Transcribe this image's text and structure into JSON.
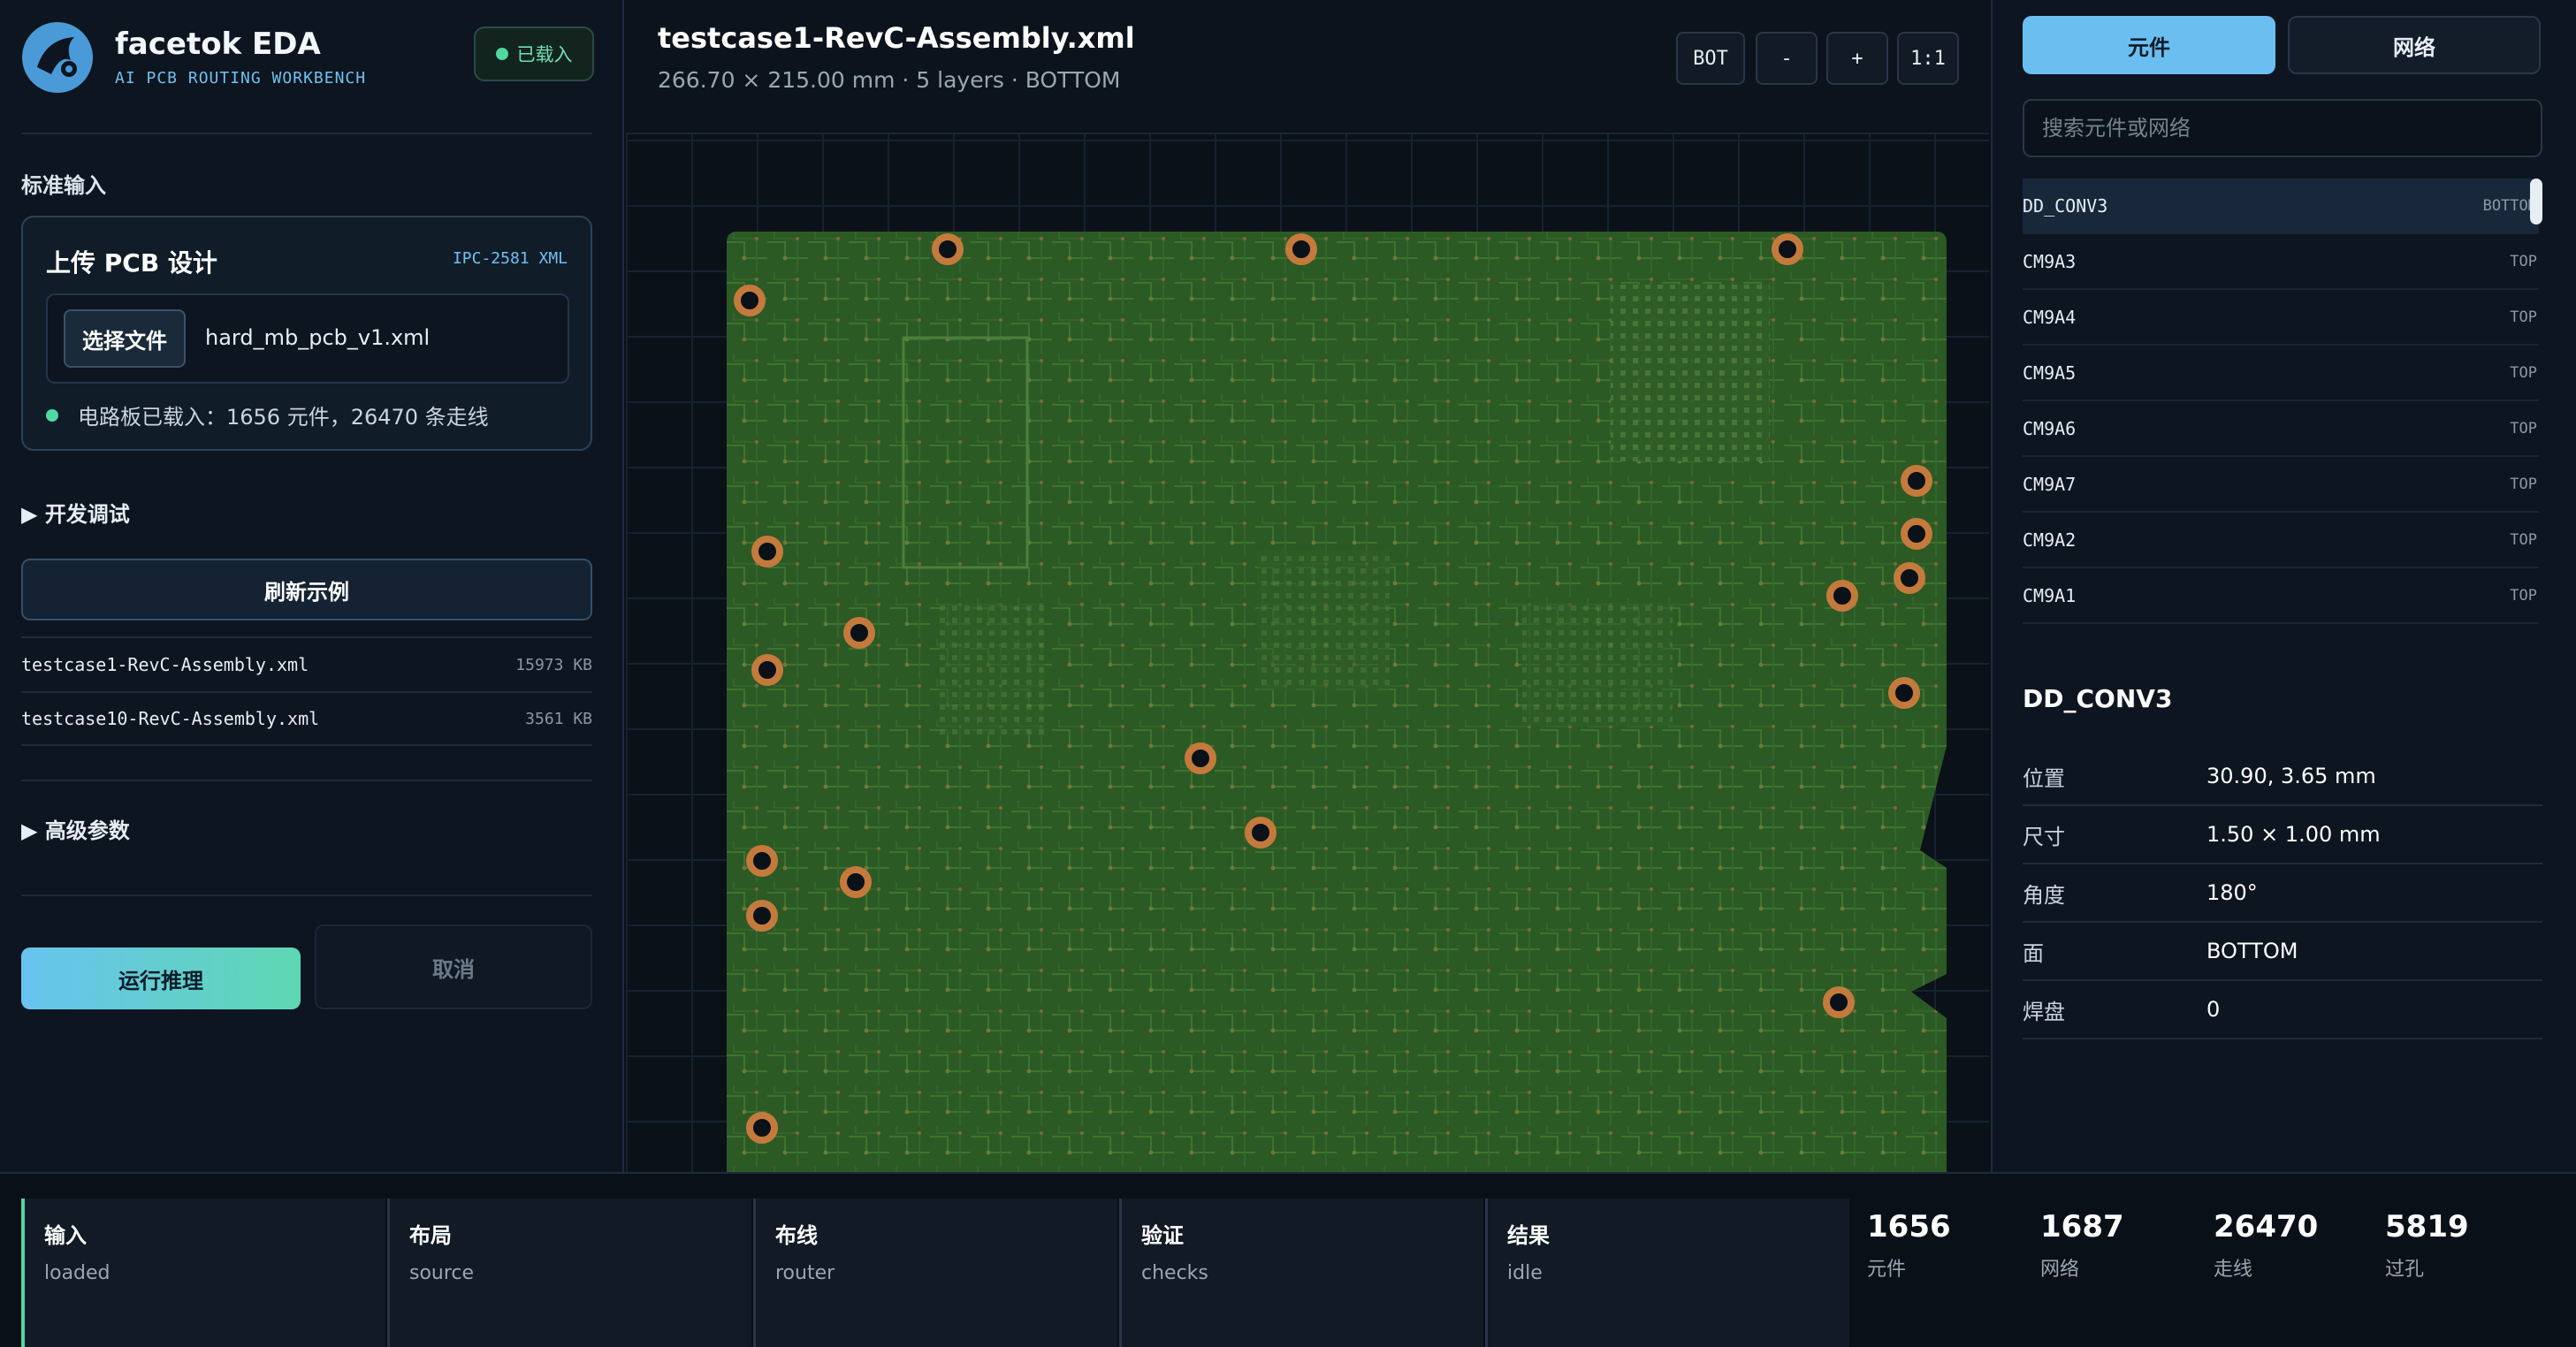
{
  "app": {
    "name": "facetok EDA",
    "subtitle": "AI PCB ROUTING WORKBENCH",
    "status_badge": "已载入"
  },
  "left": {
    "section_title": "标准输入",
    "upload": {
      "title": "上传 PCB 设计",
      "format": "IPC-2581 XML",
      "choose_label": "选择文件",
      "file_name": "hard_mb_pcb_v1.xml",
      "status": "电路板已载入：1656 元件，26470 条走线"
    },
    "dev_debug": "▶ 开发调试",
    "refresh_label": "刷新示例",
    "examples": [
      {
        "name": "testcase1-RevC-Assembly.xml",
        "size": "15973 KB"
      },
      {
        "name": "testcase10-RevC-Assembly.xml",
        "size": "3561 KB"
      }
    ],
    "advanced": "▶ 高级参数",
    "run_label": "运行推理",
    "cancel_label": "取消"
  },
  "center": {
    "title": "testcase1-RevC-Assembly.xml",
    "meta": "266.70 × 215.00 mm · 5 layers · BOTTOM",
    "buttons": {
      "side": "BOT",
      "zoom_out": "-",
      "zoom_in": "+",
      "fit": "1:1"
    }
  },
  "right": {
    "tabs": {
      "components": "元件",
      "nets": "网络"
    },
    "search_placeholder": "搜索元件或网络",
    "components": [
      {
        "id": "DD_CONV3",
        "side": "BOTTOM"
      },
      {
        "id": "CM9A3",
        "side": "TOP"
      },
      {
        "id": "CM9A4",
        "side": "TOP"
      },
      {
        "id": "CM9A5",
        "side": "TOP"
      },
      {
        "id": "CM9A6",
        "side": "TOP"
      },
      {
        "id": "CM9A7",
        "side": "TOP"
      },
      {
        "id": "CM9A2",
        "side": "TOP"
      },
      {
        "id": "CM9A1",
        "side": "TOP"
      }
    ],
    "detail": {
      "title": "DD_CONV3",
      "props": [
        {
          "key": "位置",
          "value": "30.90, 3.65 mm"
        },
        {
          "key": "尺寸",
          "value": "1.50 × 1.00 mm"
        },
        {
          "key": "角度",
          "value": "180°"
        },
        {
          "key": "面",
          "value": "BOTTOM"
        },
        {
          "key": "焊盘",
          "value": "0"
        }
      ]
    }
  },
  "bottom": {
    "stages": [
      {
        "name": "输入",
        "status": "loaded"
      },
      {
        "name": "布局",
        "status": "source"
      },
      {
        "name": "布线",
        "status": "router"
      },
      {
        "name": "验证",
        "status": "checks"
      },
      {
        "name": "结果",
        "status": "idle"
      }
    ],
    "stats": [
      {
        "value": "1656",
        "label": "元件"
      },
      {
        "value": "1687",
        "label": "网络"
      },
      {
        "value": "26470",
        "label": "走线"
      },
      {
        "value": "5819",
        "label": "过孔"
      }
    ]
  },
  "colors": {
    "accent": "#6bbff0",
    "accent_green": "#4fd9a1",
    "board": "#2c5a24",
    "copper": "#c47a3c"
  }
}
